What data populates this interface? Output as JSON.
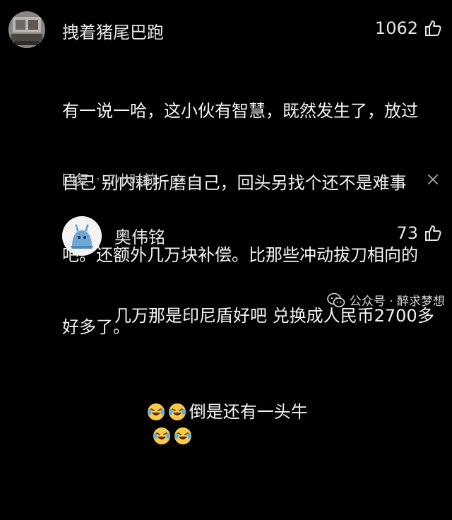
{
  "comments": [
    {
      "username": "拽着猪尾巴跑",
      "likes": "1062",
      "lines": [
        "有一说一哈，这小伙有智慧，既然发生了，放过",
        "自己 别内耗折磨自己，回头另找个还不是难事",
        "吧。还额外几万块补偿。比那些冲动拔刀相向的",
        "好多了。"
      ],
      "reply_label": "回复",
      "separator": "·",
      "time": "7小时前"
    },
    {
      "username": "奥伟铭",
      "likes": "73",
      "line1": "几万那是印尼盾好吧 兑换成人民币2700多",
      "line2_text": "倒是还有一头牛"
    }
  ],
  "icons": {
    "like": "thumb-up-icon",
    "close": "close-icon",
    "emoji": "laughing-tears-emoji",
    "watermark": "wechat-icon"
  },
  "watermark": {
    "text": "公众号 · 醉求梦想"
  },
  "colors": {
    "background": "#000000",
    "text": "#f4f4f4",
    "meta": "#bdbdbd"
  }
}
